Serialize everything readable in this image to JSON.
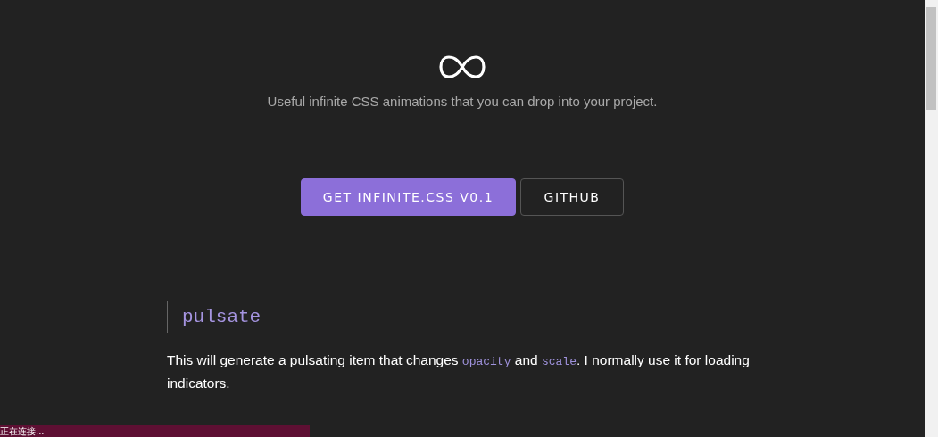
{
  "header": {
    "subtitle": "Useful infinite CSS animations that you can drop into your project."
  },
  "buttons": [
    {
      "label": "GET INFINITE.CSS V0.1",
      "kind": "primary"
    },
    {
      "label": "GITHUB",
      "kind": "outline"
    }
  ],
  "section": {
    "title": "pulsate",
    "description": [
      {
        "kind": "text",
        "text": "This will generate a pulsating item that changes "
      },
      {
        "kind": "code",
        "text": "opacity"
      },
      {
        "kind": "text",
        "text": " and "
      },
      {
        "kind": "code",
        "text": "scale"
      },
      {
        "kind": "text",
        "text": ". I normally use it for loading indicators."
      }
    ]
  },
  "status_bar": {
    "text": "正在连接..."
  }
}
